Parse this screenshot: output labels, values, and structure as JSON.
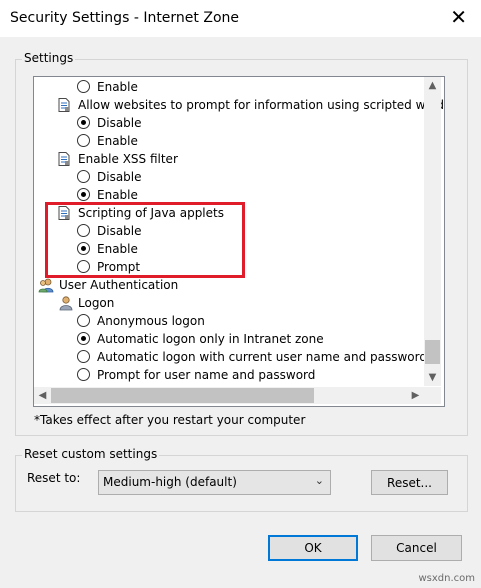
{
  "window": {
    "title": "Security Settings - Internet Zone",
    "close_glyph": "✕"
  },
  "settings_group": {
    "label": "Settings"
  },
  "tree": [
    {
      "kind": "radio",
      "label": "Enable",
      "checked": false,
      "indent": 1
    },
    {
      "kind": "header",
      "icon": "document-settings-icon",
      "label": "Allow websites to prompt for information using scripted wind"
    },
    {
      "kind": "radio",
      "label": "Disable",
      "checked": true,
      "indent": 1
    },
    {
      "kind": "radio",
      "label": "Enable",
      "checked": false,
      "indent": 1
    },
    {
      "kind": "header",
      "icon": "document-settings-icon",
      "label": "Enable XSS filter"
    },
    {
      "kind": "radio",
      "label": "Disable",
      "checked": false,
      "indent": 1
    },
    {
      "kind": "radio",
      "label": "Enable",
      "checked": true,
      "indent": 1
    },
    {
      "kind": "header",
      "icon": "document-settings-icon",
      "label": "Scripting of Java applets"
    },
    {
      "kind": "radio",
      "label": "Disable",
      "checked": false,
      "indent": 1
    },
    {
      "kind": "radio",
      "label": "Enable",
      "checked": true,
      "indent": 1
    },
    {
      "kind": "radio",
      "label": "Prompt",
      "checked": false,
      "indent": 1
    },
    {
      "kind": "category",
      "icon": "users-icon",
      "label": "User Authentication"
    },
    {
      "kind": "subheader",
      "icon": "user-icon",
      "label": "Logon"
    },
    {
      "kind": "radio",
      "label": "Anonymous logon",
      "checked": false,
      "indent": 1
    },
    {
      "kind": "radio",
      "label": "Automatic logon only in Intranet zone",
      "checked": true,
      "indent": 1
    },
    {
      "kind": "radio",
      "label": "Automatic logon with current user name and password",
      "checked": false,
      "indent": 1
    },
    {
      "kind": "radio",
      "label": "Prompt for user name and password",
      "checked": false,
      "indent": 1
    }
  ],
  "scrollbars": {
    "up": "▲",
    "down": "▼",
    "left": "◀",
    "right": "▶"
  },
  "note": "*Takes effect after you restart your computer",
  "reset_group": {
    "label": "Reset custom settings",
    "reset_to_label": "Reset to:",
    "reset_to_value": "Medium-high (default)",
    "chevron": "⌄",
    "reset_button": "Reset..."
  },
  "buttons": {
    "ok": "OK",
    "cancel": "Cancel"
  },
  "watermark": "wsxdn.com",
  "colors": {
    "highlight_border": "#e01c2a",
    "default_button_border": "#0078d7"
  }
}
